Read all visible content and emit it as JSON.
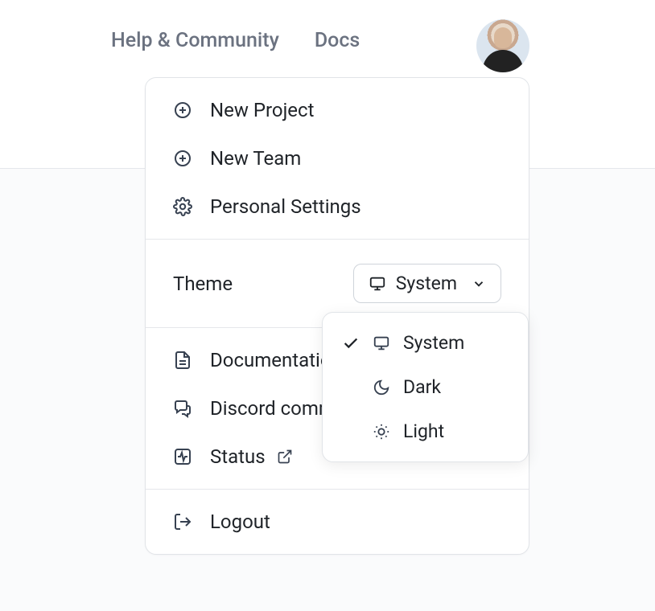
{
  "nav": {
    "help_community": "Help & Community",
    "docs": "Docs"
  },
  "menu": {
    "new_project": "New Project",
    "new_team": "New Team",
    "personal_settings": "Personal Settings",
    "theme_label": "Theme",
    "theme_selected": "System",
    "documentation": "Documentation",
    "discord": "Discord community",
    "status": "Status",
    "logout": "Logout"
  },
  "theme_options": {
    "system": "System",
    "dark": "Dark",
    "light": "Light"
  }
}
